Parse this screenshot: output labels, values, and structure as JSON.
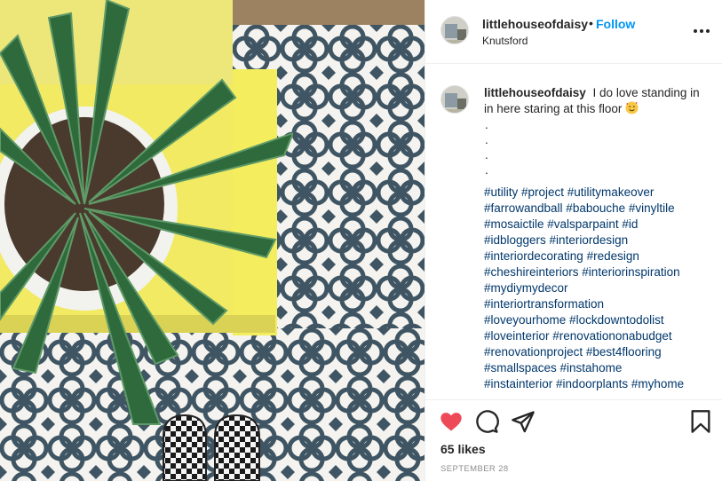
{
  "post": {
    "username": "littlehouseofdaisy",
    "separator": "•",
    "follow_label": "Follow",
    "location": "Knutsford",
    "caption_user": "littlehouseofdaisy",
    "caption_text": "I do love standing in in here staring at this floor",
    "caption_emoji": "smiling-face-with-hearts-emoji",
    "dots": [
      ".",
      ".",
      ".",
      "."
    ],
    "hashtags": [
      "#utility #project #utilitymakeover",
      "#farrowandball #babouche #vinyltile",
      "#mosaictile #valsparpaint #id",
      "#idbloggers #interiordesign",
      "#interiordecorating #redesign",
      "#cheshireinteriors #interiorinspiration",
      "#mydiymydecor",
      "#interiortransformation",
      "#loveyourhome #lockdowntodolist",
      "#loveinterior #renovationonabudget",
      "#renovationproject #best4flooring",
      "#smallspaces #instahome",
      "#instainterior #indoorplants #myhome"
    ],
    "likes": "65 likes",
    "date": "SEPTEMBER 28"
  },
  "icons": {
    "more": "more-options-icon",
    "like": "heart-filled-icon",
    "comment": "comment-icon",
    "share": "share-icon",
    "save": "bookmark-icon"
  },
  "colors": {
    "accent": "#0095f6",
    "liked": "#ed4956",
    "hashtag": "#00376b",
    "muted": "#8e8e8e",
    "tile_pattern": "#3f5563",
    "wall_yellow": "#f1ea62"
  }
}
